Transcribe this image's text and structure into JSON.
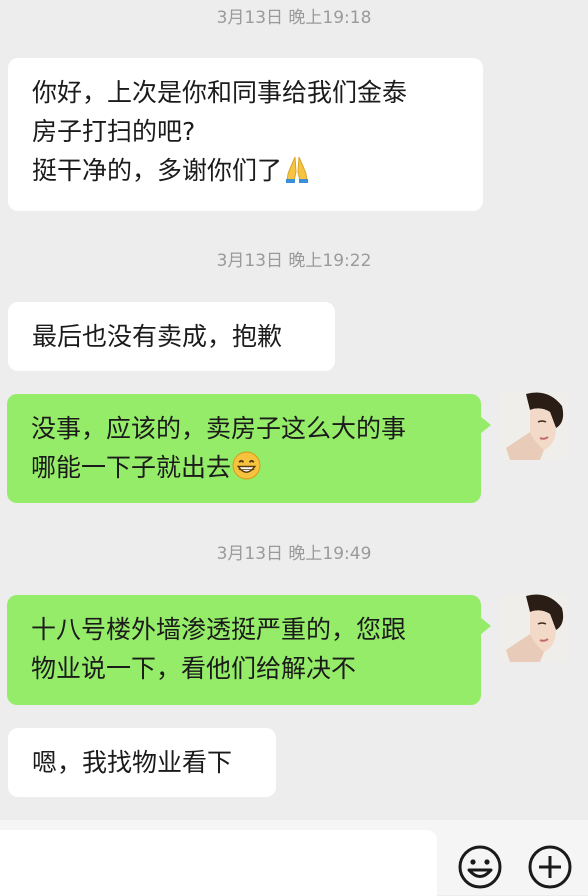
{
  "messages": [
    {
      "type": "timestamp",
      "text": "3月13日 晚上19:18"
    },
    {
      "type": "incoming",
      "lines": [
        "你好，上次是你和同事给我们金泰",
        "房子打扫的吧?",
        "挺干净的，多谢你们了"
      ],
      "emoji": "folded-hands"
    },
    {
      "type": "timestamp",
      "text": "3月13日 晚上19:22"
    },
    {
      "type": "incoming",
      "lines": [
        "最后也没有卖成，抱歉"
      ]
    },
    {
      "type": "outgoing",
      "lines": [
        "没事，应该的，卖房子这么大的事",
        "哪能一下子就出去"
      ],
      "emoji": "grinning-face"
    },
    {
      "type": "timestamp",
      "text": "3月13日 晚上19:49"
    },
    {
      "type": "outgoing",
      "lines": [
        "十八号楼外墙渗透挺严重的，您跟",
        "物业说一下，看他们给解决不"
      ]
    },
    {
      "type": "incoming",
      "lines": [
        "嗯，我找物业看下"
      ]
    }
  ],
  "input_bar": {
    "icons": [
      "emoji-icon",
      "plus-icon"
    ]
  },
  "colors": {
    "background": "#ededed",
    "incoming_bubble": "#ffffff",
    "outgoing_bubble": "#95ec69",
    "timestamp": "#9a9a9a"
  }
}
